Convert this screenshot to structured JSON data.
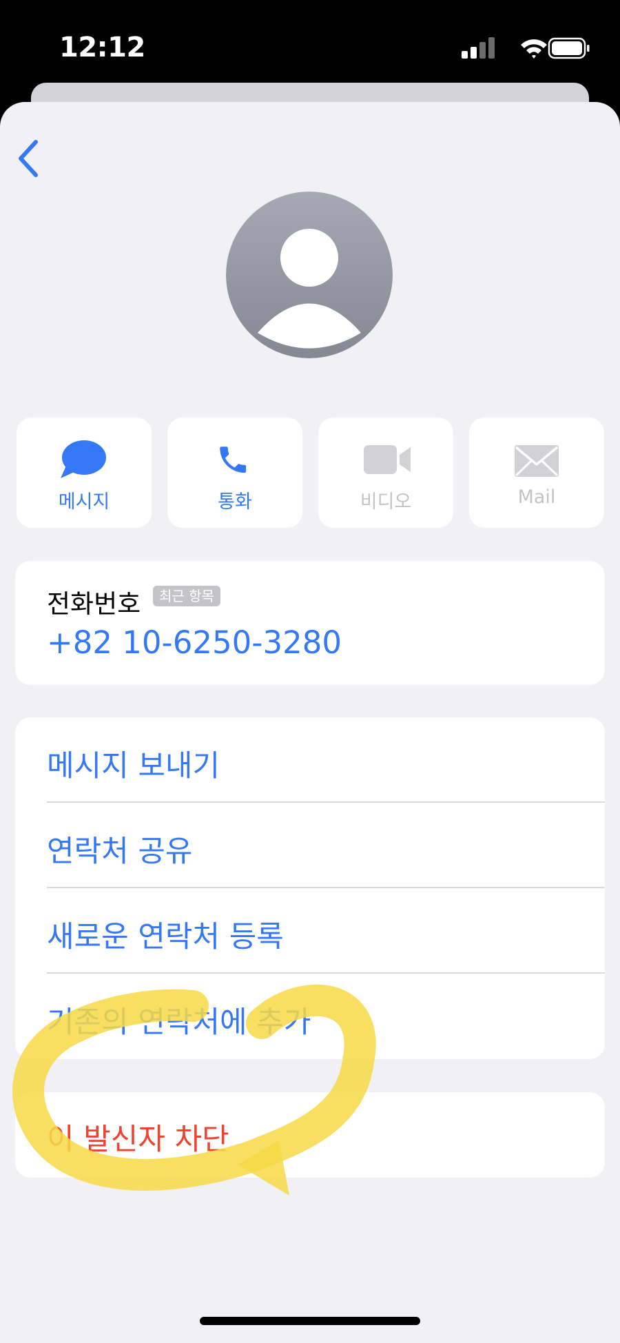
{
  "status_bar": {
    "time": "12:12"
  },
  "actions": [
    {
      "label": "메시지",
      "enabled": true
    },
    {
      "label": "통화",
      "enabled": true
    },
    {
      "label": "비디오",
      "enabled": false
    },
    {
      "label": "Mail",
      "enabled": false
    }
  ],
  "phone": {
    "title": "전화번호",
    "badge": "최근 항목",
    "number": "+82 10-6250-3280"
  },
  "menu": {
    "items": [
      "메시지 보내기",
      "연락처 공유",
      "새로운 연락처 등록",
      "기존의 연락처에 추가"
    ]
  },
  "block": {
    "label": "이 발신자 차단"
  },
  "colors": {
    "accent": "#3478f6",
    "destructive": "#f0432f",
    "disabled": "#c4c4c8",
    "background": "#f0f0f5",
    "highlight": "#f7d945"
  }
}
